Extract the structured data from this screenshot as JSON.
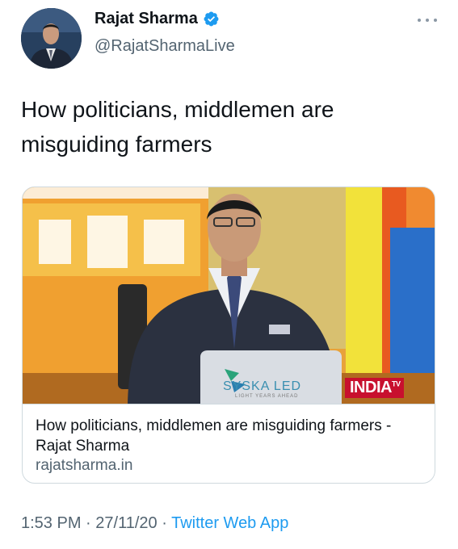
{
  "author": {
    "name": "Rajat Sharma",
    "handle": "@RajatSharmaLive",
    "verified": true
  },
  "tweet": {
    "text": "How politicians, middlemen are misguiding farmers"
  },
  "card": {
    "title": "How politicians, middlemen are misguiding farmers - Rajat Sharma",
    "domain": "rajatsharma.in",
    "channel_logo": "INDIA",
    "channel_logo_sup": "TV",
    "laptop_brand": "SYSKA LED",
    "laptop_tagline": "LIGHT YEARS AHEAD"
  },
  "meta": {
    "time": "1:53 PM",
    "separator": "·",
    "date": "27/11/20",
    "app": "Twitter Web App"
  },
  "colors": {
    "verified": "#1d9bf0",
    "link": "#1d9bf0",
    "secondary_text": "#536471",
    "border": "#cfd9de"
  },
  "icons": {
    "verified": "verified-badge-icon",
    "more": "more-horizontal-icon"
  }
}
